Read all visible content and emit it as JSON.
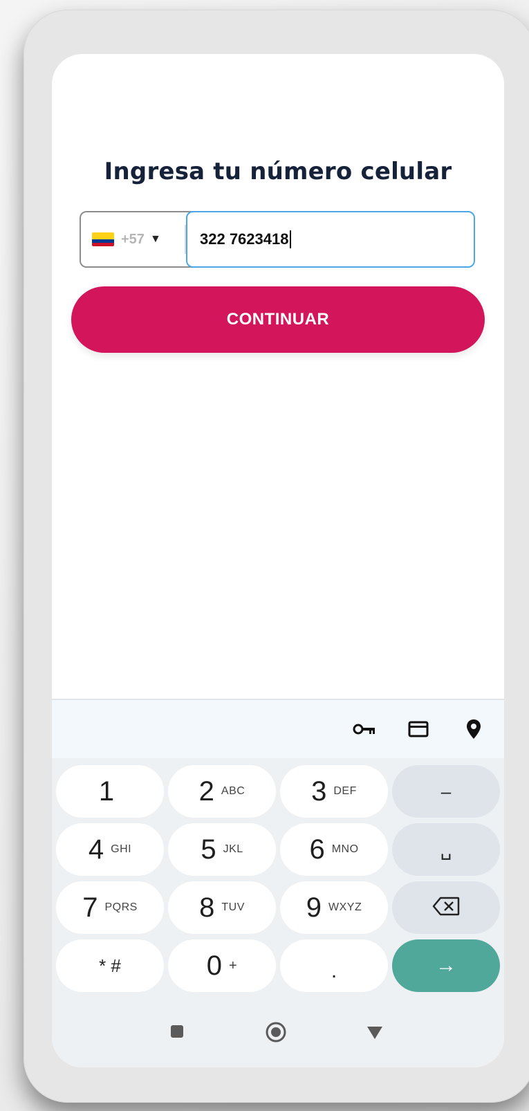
{
  "screen": {
    "title": "Ingresa tu número celular"
  },
  "phone_input": {
    "country_flag": "colombia-flag",
    "country_code": "+57",
    "number_value": "322 7623418",
    "focus_color": "#4aa8e8"
  },
  "continue_button": {
    "label": "CONTINUAR",
    "color": "#d3165c"
  },
  "keyboard": {
    "suggestion_icons": [
      "key-icon",
      "credit-card-icon",
      "location-pin-icon"
    ],
    "rows": [
      [
        {
          "digit": "1",
          "letters": ""
        },
        {
          "digit": "2",
          "letters": "ABC"
        },
        {
          "digit": "3",
          "letters": "DEF"
        },
        {
          "symbol": "–"
        }
      ],
      [
        {
          "digit": "4",
          "letters": "GHI"
        },
        {
          "digit": "5",
          "letters": "JKL"
        },
        {
          "digit": "6",
          "letters": "MNO"
        },
        {
          "symbol": "␣"
        }
      ],
      [
        {
          "digit": "7",
          "letters": "PQRS"
        },
        {
          "digit": "8",
          "letters": "TUV"
        },
        {
          "digit": "9",
          "letters": "WXYZ"
        },
        {
          "symbol": "backspace"
        }
      ],
      [
        {
          "digit": "* #",
          "letters": ""
        },
        {
          "digit": "0",
          "letters": "+"
        },
        {
          "digit": ".",
          "letters": ""
        },
        {
          "symbol": "→"
        }
      ]
    ],
    "enter_color": "#4fa89a"
  },
  "navbar": {
    "items": [
      "recents-square-icon",
      "home-circle-icon",
      "back-triangle-icon"
    ]
  }
}
